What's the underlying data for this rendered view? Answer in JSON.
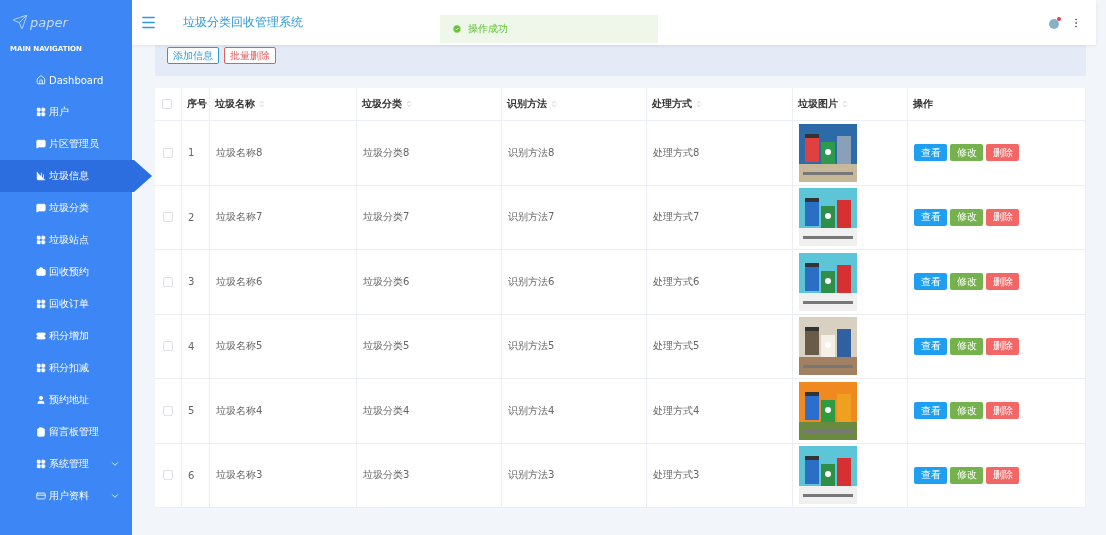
{
  "sidebar": {
    "logo": "paper",
    "section_title": "MAIN NAVIGATION",
    "items": [
      {
        "label": "Dashboard",
        "selected": false,
        "expandable": false
      },
      {
        "label": "用户",
        "selected": false,
        "expandable": false
      },
      {
        "label": "片区管理员",
        "selected": false,
        "expandable": false
      },
      {
        "label": "垃圾信息",
        "selected": true,
        "expandable": false
      },
      {
        "label": "垃圾分类",
        "selected": false,
        "expandable": false
      },
      {
        "label": "垃圾站点",
        "selected": false,
        "expandable": false
      },
      {
        "label": "回收预约",
        "selected": false,
        "expandable": false
      },
      {
        "label": "回收订单",
        "selected": false,
        "expandable": false
      },
      {
        "label": "积分增加",
        "selected": false,
        "expandable": false
      },
      {
        "label": "积分扣减",
        "selected": false,
        "expandable": false
      },
      {
        "label": "预约地址",
        "selected": false,
        "expandable": false
      },
      {
        "label": "留言板管理",
        "selected": false,
        "expandable": false
      },
      {
        "label": "系统管理",
        "selected": false,
        "expandable": true
      },
      {
        "label": "用户资料",
        "selected": false,
        "expandable": true
      }
    ]
  },
  "header": {
    "title": "垃圾分类回收管理系统"
  },
  "toast": {
    "message": "操作成功"
  },
  "toolbar": {
    "buttons": [
      {
        "label": "添加信息",
        "kind": "add"
      },
      {
        "label": "批量删除",
        "kind": "delete"
      }
    ]
  },
  "table": {
    "all_checked": false,
    "columns": [
      {
        "label": "序号"
      },
      {
        "label": "垃圾名称",
        "sortable": true
      },
      {
        "label": "垃圾分类",
        "sortable": true
      },
      {
        "label": "识别方法",
        "sortable": true
      },
      {
        "label": "处理方式",
        "sortable": true
      },
      {
        "label": "垃圾图片",
        "sortable": true
      },
      {
        "label": "操作",
        "sortable": false
      }
    ],
    "rows": [
      {
        "checked": false,
        "index": "1",
        "name": "垃圾名称8",
        "category": "垃圾分类8",
        "method": "识别方法8",
        "treatment": "处理方式8",
        "actions": [
          {
            "label": "查看",
            "kind": "view"
          },
          {
            "label": "修改",
            "kind": "edit"
          },
          {
            "label": "删除",
            "kind": "delete"
          }
        ]
      },
      {
        "checked": false,
        "index": "2",
        "name": "垃圾名称7",
        "category": "垃圾分类7",
        "method": "识别方法7",
        "treatment": "处理方式7",
        "actions": [
          {
            "label": "查看",
            "kind": "view"
          },
          {
            "label": "修改",
            "kind": "edit"
          },
          {
            "label": "删除",
            "kind": "delete"
          }
        ]
      },
      {
        "checked": false,
        "index": "3",
        "name": "垃圾名称6",
        "category": "垃圾分类6",
        "method": "识别方法6",
        "treatment": "处理方式6",
        "actions": [
          {
            "label": "查看",
            "kind": "view"
          },
          {
            "label": "修改",
            "kind": "edit"
          },
          {
            "label": "删除",
            "kind": "delete"
          }
        ]
      },
      {
        "checked": false,
        "index": "4",
        "name": "垃圾名称5",
        "category": "垃圾分类5",
        "method": "识别方法5",
        "treatment": "处理方式5",
        "actions": [
          {
            "label": "查看",
            "kind": "view"
          },
          {
            "label": "修改",
            "kind": "edit"
          },
          {
            "label": "删除",
            "kind": "delete"
          }
        ]
      },
      {
        "checked": false,
        "index": "5",
        "name": "垃圾名称4",
        "category": "垃圾分类4",
        "method": "识别方法4",
        "treatment": "处理方式4",
        "actions": [
          {
            "label": "查看",
            "kind": "view"
          },
          {
            "label": "修改",
            "kind": "edit"
          },
          {
            "label": "删除",
            "kind": "delete"
          }
        ]
      },
      {
        "checked": false,
        "index": "6",
        "name": "垃圾名称3",
        "category": "垃圾分类3",
        "method": "识别方法3",
        "treatment": "处理方式3",
        "actions": [
          {
            "label": "查看",
            "kind": "view"
          },
          {
            "label": "修改",
            "kind": "edit"
          },
          {
            "label": "删除",
            "kind": "delete"
          }
        ]
      }
    ]
  }
}
